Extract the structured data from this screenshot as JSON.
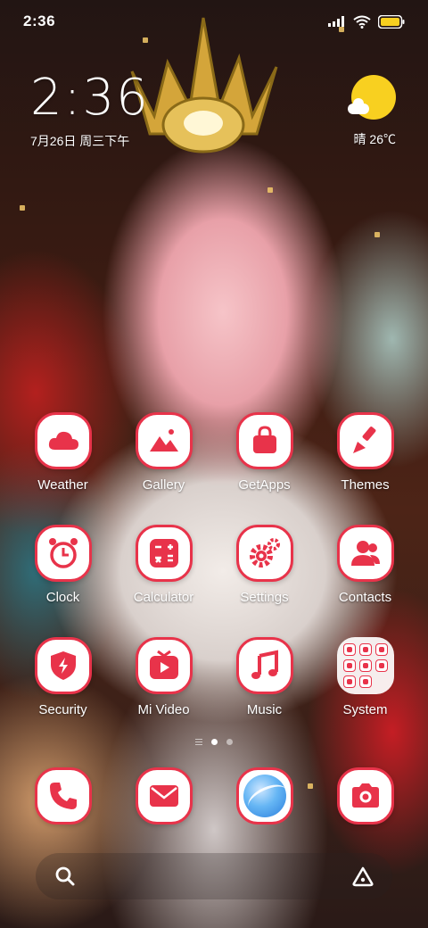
{
  "status_bar": {
    "time": "2:36",
    "icons": [
      "signal-icon",
      "wifi-icon",
      "battery-icon"
    ]
  },
  "clock_widget": {
    "time": "2:36",
    "date": "7月26日 周三下午"
  },
  "weather_widget": {
    "icon": "sun-cloud-icon",
    "text": "晴 26℃"
  },
  "apps": [
    {
      "label": "Weather",
      "icon": "cloud-icon"
    },
    {
      "label": "Gallery",
      "icon": "mountain-icon"
    },
    {
      "label": "GetApps",
      "icon": "shopping-bag-icon"
    },
    {
      "label": "Themes",
      "icon": "paintbrush-icon"
    },
    {
      "label": "Clock",
      "icon": "alarm-clock-icon"
    },
    {
      "label": "Calculator",
      "icon": "calculator-icon"
    },
    {
      "label": "Settings",
      "icon": "gear-icon"
    },
    {
      "label": "Contacts",
      "icon": "contacts-icon"
    },
    {
      "label": "Security",
      "icon": "shield-bolt-icon"
    },
    {
      "label": "Mi Video",
      "icon": "tv-play-icon"
    },
    {
      "label": "Music",
      "icon": "music-note-icon"
    },
    {
      "label": "System",
      "icon": "folder-icon"
    }
  ],
  "page_indicator": {
    "pages": 2,
    "active": 1
  },
  "dock": [
    {
      "icon": "phone-icon"
    },
    {
      "icon": "message-icon"
    },
    {
      "icon": "browser-icon"
    },
    {
      "icon": "camera-icon"
    }
  ],
  "search_bar": {
    "left_icon": "search-icon",
    "right_icon": "assistant-icon"
  },
  "colors": {
    "accent": "#e8334a",
    "icon_bg": "#ffffff",
    "sun": "#f8d020"
  }
}
